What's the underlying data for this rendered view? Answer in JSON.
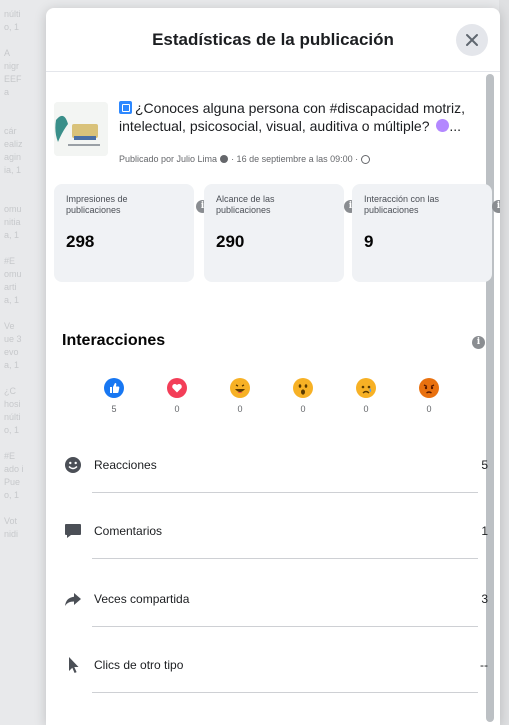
{
  "background_text": [
    "núlti",
    "o, 1",
    "",
    "A",
    "nigr",
    "EEF",
    "a",
    "",
    "",
    "cár",
    "ealiz",
    "agin",
    "ia, 1",
    "",
    "",
    "omu",
    "nitia",
    "a, 1",
    "",
    "#E",
    "omu",
    "arti",
    "a, 1",
    "",
    "Ve",
    "ue 3",
    "evo",
    "a, 1",
    "",
    "¿C",
    "hosi",
    "núlti",
    "o, 1",
    "",
    "#E",
    "ado i",
    "Pue",
    "o, 1",
    "",
    "Vot",
    "nidi"
  ],
  "dialog": {
    "title": "Estadísticas de la publicación",
    "close_icon": "close-icon"
  },
  "post": {
    "text": "¿Conoces alguna persona con #discapacidad motriz, intelectual, psicosocial, visual, auditiva o múltiple? ",
    "text_suffix": "...",
    "meta_prefix": "Publicado por Julio Lima",
    "meta_date": "· 16 de septiembre a las 09:00 ·"
  },
  "stats": [
    {
      "label": "Impresiones de publicaciones",
      "value": "298"
    },
    {
      "label": "Alcance de las publicaciones",
      "value": "290"
    },
    {
      "label": "Interacción con las publicaciones",
      "value": "9"
    }
  ],
  "interactions": {
    "title": "Interacciones",
    "reactions": [
      {
        "name": "like",
        "count": "5",
        "color": "#1877f2"
      },
      {
        "name": "love",
        "count": "0",
        "color": "#f33e58"
      },
      {
        "name": "haha",
        "count": "0",
        "color": "#f7b125"
      },
      {
        "name": "wow",
        "count": "0",
        "color": "#f7b125"
      },
      {
        "name": "sad",
        "count": "0",
        "color": "#f7b125"
      },
      {
        "name": "angry",
        "count": "0",
        "color": "#e9710f"
      }
    ],
    "rows": [
      {
        "label": "Reacciones",
        "value": "5",
        "icon": "smiley-icon"
      },
      {
        "label": "Comentarios",
        "value": "1",
        "icon": "comment-icon"
      },
      {
        "label": "Veces compartida",
        "value": "3",
        "icon": "share-icon"
      },
      {
        "label": "Clics de otro tipo",
        "value": "--",
        "icon": "cursor-icon"
      }
    ]
  }
}
